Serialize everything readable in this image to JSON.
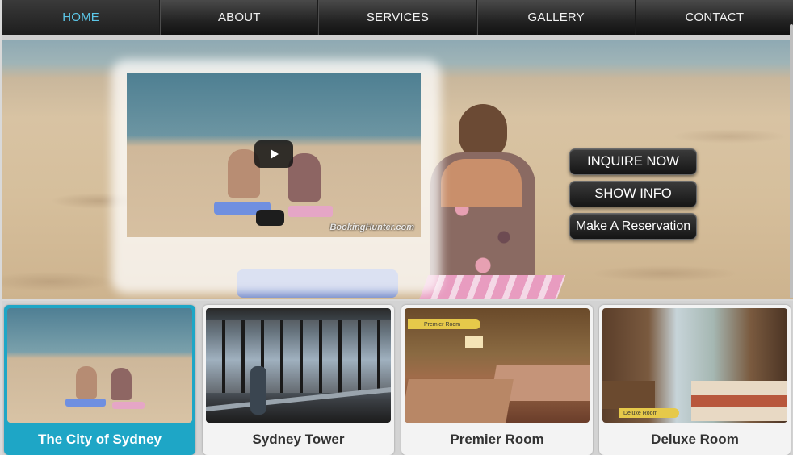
{
  "nav": {
    "items": [
      {
        "label": "HOME",
        "active": true
      },
      {
        "label": "ABOUT",
        "active": false
      },
      {
        "label": "SERVICES",
        "active": false
      },
      {
        "label": "GALLERY",
        "active": false
      },
      {
        "label": "CONTACT",
        "active": false
      }
    ],
    "active_color": "#5cc7e8"
  },
  "hero": {
    "video": {
      "watermark": "BookingHunter.com",
      "play_icon": "play-icon"
    },
    "buttons": {
      "inquire": "INQUIRE NOW",
      "show_info": "SHOW INFO",
      "reservation": "Make A Reservation"
    }
  },
  "cards": [
    {
      "label": "The City of Sydney",
      "active": true
    },
    {
      "label": "Sydney Tower",
      "active": false
    },
    {
      "label": "Premier Room",
      "active": false
    },
    {
      "label": "Deluxe Room",
      "active": false
    }
  ],
  "card_tags": {
    "premier": "Premier Room",
    "deluxe": "Deluxe Room"
  },
  "colors": {
    "accent": "#1ea6c6"
  }
}
